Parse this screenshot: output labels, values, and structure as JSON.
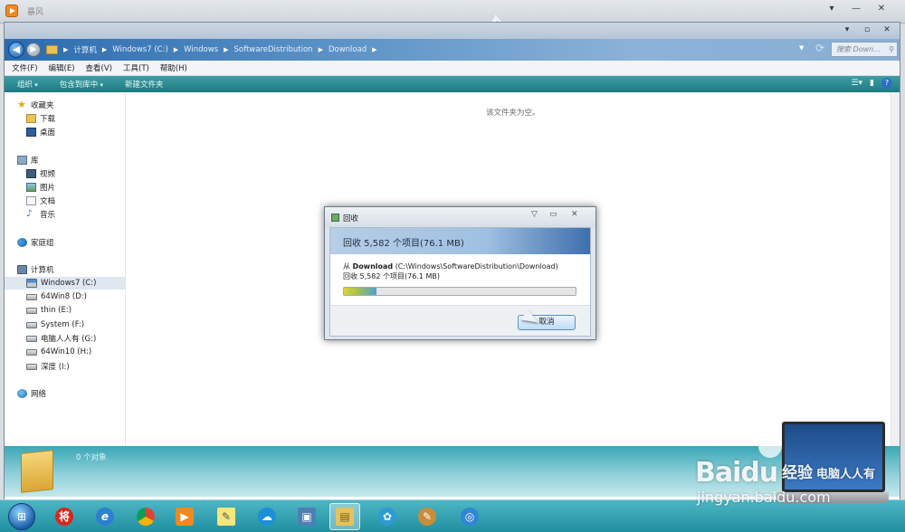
{
  "background": {
    "title": "暴风"
  },
  "window": {
    "controls": [
      "▾",
      "▫",
      "✕"
    ]
  },
  "address": {
    "breadcrumb": [
      "计算机",
      "Windows7 (C:)",
      "Windows",
      "SoftwareDistribution",
      "Download"
    ],
    "search_placeholder": "搜索 Down..."
  },
  "menu": [
    "文件(F)",
    "编辑(E)",
    "查看(V)",
    "工具(T)",
    "帮助(H)"
  ],
  "commands": {
    "organize": "组织",
    "include": "包含到库中",
    "new_folder": "新建文件夹"
  },
  "nav": {
    "favorites": "收藏夹",
    "downloads": "下载",
    "desktop": "桌面",
    "libraries": "库",
    "videos": "视频",
    "pictures": "图片",
    "documents": "文档",
    "music": "音乐",
    "homegroup": "家庭组",
    "computer": "计算机",
    "drives": [
      "Windows7 (C:)",
      "64Win8 (D:)",
      "thin (E:)",
      "System (F:)",
      "电脑人人有 (G:)",
      "64Win10 (H:)",
      "深度 (I:)"
    ],
    "network": "网络"
  },
  "content": {
    "empty_text": "该文件夹为空。"
  },
  "details": {
    "count": "0 个对象"
  },
  "dialog": {
    "title": "回收",
    "heading": "回收 5,582 个项目(76.1 MB)",
    "from_label": "从",
    "from_name": "Download",
    "from_path": "(C:\\Windows\\SoftwareDistribution\\Download)",
    "sub": "回收 5,582 个项目(76.1 MB)",
    "cancel": "取消",
    "progress": 0.14
  },
  "watermark": {
    "logo": "Baidu",
    "cn": "经验",
    "banner": "电脑人人有",
    "url": "jingyan.baidu.com"
  }
}
